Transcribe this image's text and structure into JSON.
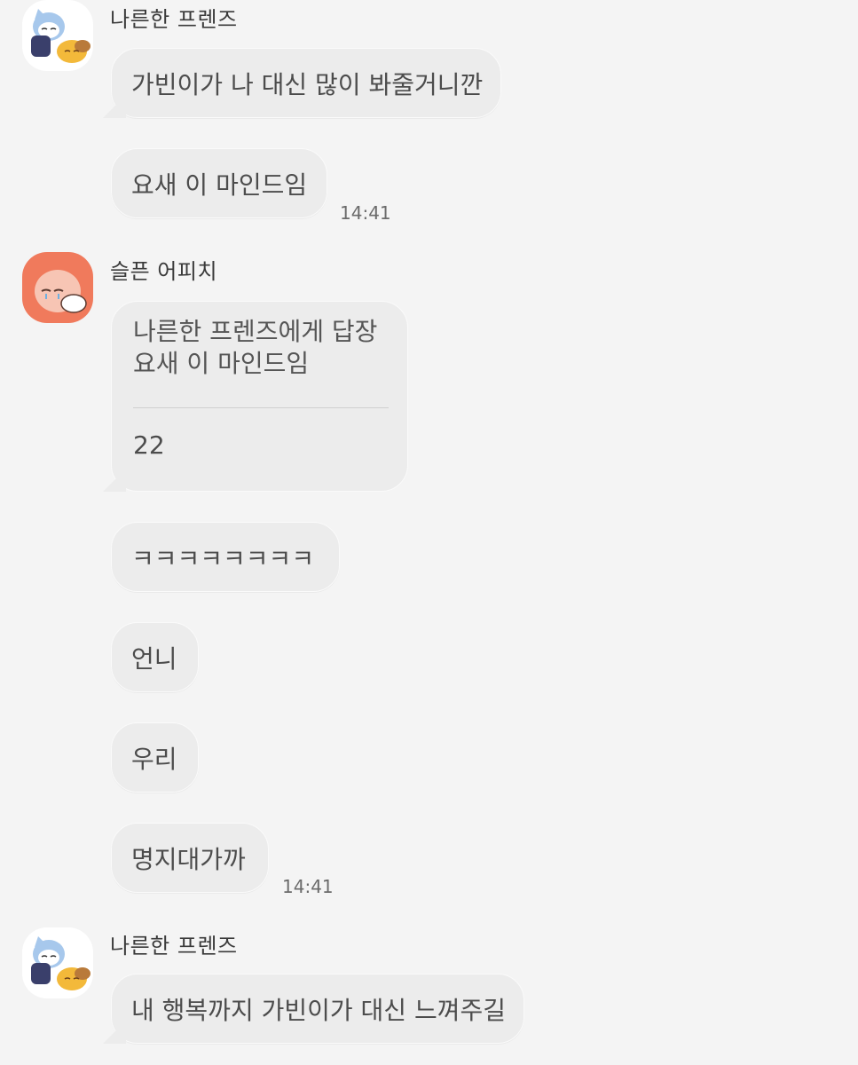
{
  "messages": [
    {
      "sender": "나른한 프렌즈",
      "bubbles": [
        "가빈이가 나 대신 많이 봐줄거니깐",
        "요새 이 마인드임"
      ],
      "time": "14:41"
    },
    {
      "sender": "슬픈 어피치",
      "reply": {
        "header": "나른한 프렌즈에게 답장",
        "quoted": "요새 이 마인드임",
        "text": "22"
      },
      "bubbles": [
        "ㅋㅋㅋㅋㅋㅋㅋㅋ",
        "언니",
        "우리",
        "명지대가까"
      ],
      "time": "14:41"
    },
    {
      "sender": "나른한 프렌즈",
      "bubbles": [
        "내 행복까지 가빈이가 대신 느껴주길"
      ]
    }
  ],
  "avatars": {
    "friends": "sleeping-friends-avatar-icon",
    "apeach": "sad-apeach-avatar-icon"
  },
  "colors": {
    "background": "#f4f4f4",
    "bubble": "#ececec",
    "apeach": "#f07a5c"
  }
}
